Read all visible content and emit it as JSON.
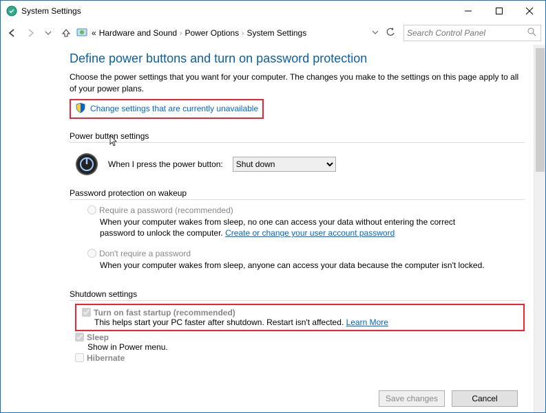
{
  "window": {
    "title": "System Settings"
  },
  "breadcrumb": {
    "prefix": "«",
    "items": [
      "Hardware and Sound",
      "Power Options",
      "System Settings"
    ]
  },
  "search": {
    "placeholder": "Search Control Panel"
  },
  "page": {
    "heading": "Define power buttons and turn on password protection",
    "intro": "Choose the power settings that you want for your computer. The changes you make to the settings on this page apply to all of your power plans.",
    "change_link": "Change settings that are currently unavailable"
  },
  "power_button": {
    "section_title": "Power button settings",
    "label": "When I press the power button:",
    "value": "Shut down"
  },
  "password": {
    "section_title": "Password protection on wakeup",
    "opt1_label": "Require a password (recommended)",
    "opt1_desc_a": "When your computer wakes from sleep, no one can access your data without entering the correct password to unlock the computer. ",
    "opt1_link": "Create or change your user account password",
    "opt2_label": "Don't require a password",
    "opt2_desc": "When your computer wakes from sleep, anyone can access your data because the computer isn't locked."
  },
  "shutdown": {
    "section_title": "Shutdown settings",
    "fast_label": "Turn on fast startup (recommended)",
    "fast_desc": "This helps start your PC faster after shutdown. Restart isn't affected. ",
    "fast_link": "Learn More",
    "sleep_label": "Sleep",
    "sleep_desc": "Show in Power menu.",
    "hibernate_label": "Hibernate"
  },
  "buttons": {
    "save": "Save changes",
    "cancel": "Cancel"
  }
}
